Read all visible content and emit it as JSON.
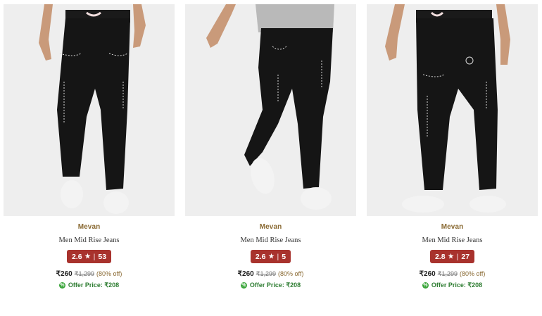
{
  "products": [
    {
      "brand": "Mevan",
      "title": "Men Mid Rise Jeans",
      "rating": "2.6",
      "star": "★",
      "reviews": "53",
      "price": "₹260",
      "mrp": "₹1,299",
      "discount": "(80% off)",
      "offer_price": "Offer Price: ₹208",
      "offer_icon": "%"
    },
    {
      "brand": "Mevan",
      "title": "Men Mid Rise Jeans",
      "rating": "2.6",
      "star": "★",
      "reviews": "5",
      "price": "₹260",
      "mrp": "₹1,299",
      "discount": "(80% off)",
      "offer_price": "Offer Price: ₹208",
      "offer_icon": "%"
    },
    {
      "brand": "Mevan",
      "title": "Men Mid Rise Jeans",
      "rating": "2.8",
      "star": "★",
      "reviews": "27",
      "price": "₹260",
      "mrp": "₹1,299",
      "discount": "(80% off)",
      "offer_price": "Offer Price: ₹208",
      "offer_icon": "%"
    }
  ],
  "rating_separator": "|",
  "colors": {
    "brand": "#8a6a33",
    "rating_badge": "#a8322d",
    "offer_green": "#2e7d32",
    "image_bg": "#eeeeee"
  }
}
